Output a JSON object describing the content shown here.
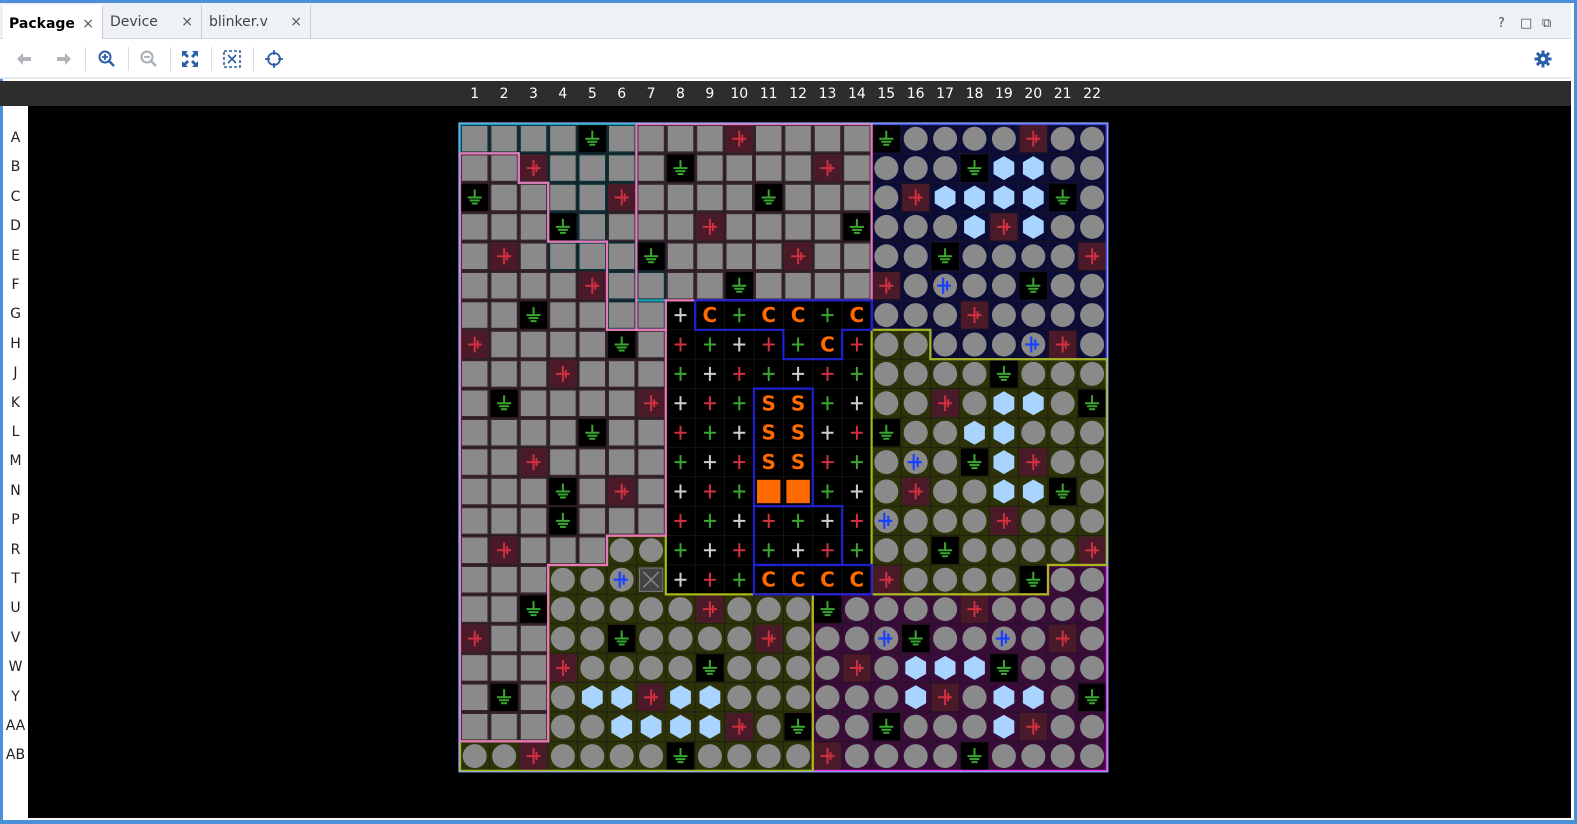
{
  "tabs": [
    {
      "label": "Package",
      "active": true
    },
    {
      "label": "Device",
      "active": false
    },
    {
      "label": "blinker.v",
      "active": false
    }
  ],
  "tab_close_glyph": "×",
  "window_controls": [
    "?",
    "□",
    "⧉"
  ],
  "toolbar": {
    "icons": [
      "back-arrow-icon",
      "forward-arrow-icon",
      "zoom-in-icon",
      "zoom-out-icon",
      "zoom-fit-icon",
      "zoom-selection-icon",
      "crosshair-icon",
      "gear-icon"
    ]
  },
  "package": {
    "columns": [
      "1",
      "2",
      "3",
      "4",
      "5",
      "6",
      "7",
      "8",
      "9",
      "10",
      "11",
      "12",
      "13",
      "14",
      "15",
      "16",
      "17",
      "18",
      "19",
      "20",
      "21",
      "22"
    ],
    "rows": [
      "A",
      "B",
      "C",
      "D",
      "E",
      "F",
      "G",
      "H",
      "J",
      "K",
      "L",
      "M",
      "N",
      "P",
      "R",
      "T",
      "U",
      "V",
      "W",
      "Y",
      "AA",
      "AB"
    ],
    "pin_glyphs": {
      "config": "C",
      "sys": "S"
    },
    "colors": {
      "pink_bank": "#e87ab8",
      "teal_bank": "#1aa0b8",
      "olive_bank": "#a8b818",
      "navy_bank": "#5050e0",
      "magenta_bank": "#e030e0",
      "blue_block": "#2020d0",
      "gnd": "#3aa830",
      "vcc": "#d03040",
      "io_gray": "#8a8a8a",
      "orange": "#ff6a00",
      "hex": "#a8d4ff"
    }
  }
}
